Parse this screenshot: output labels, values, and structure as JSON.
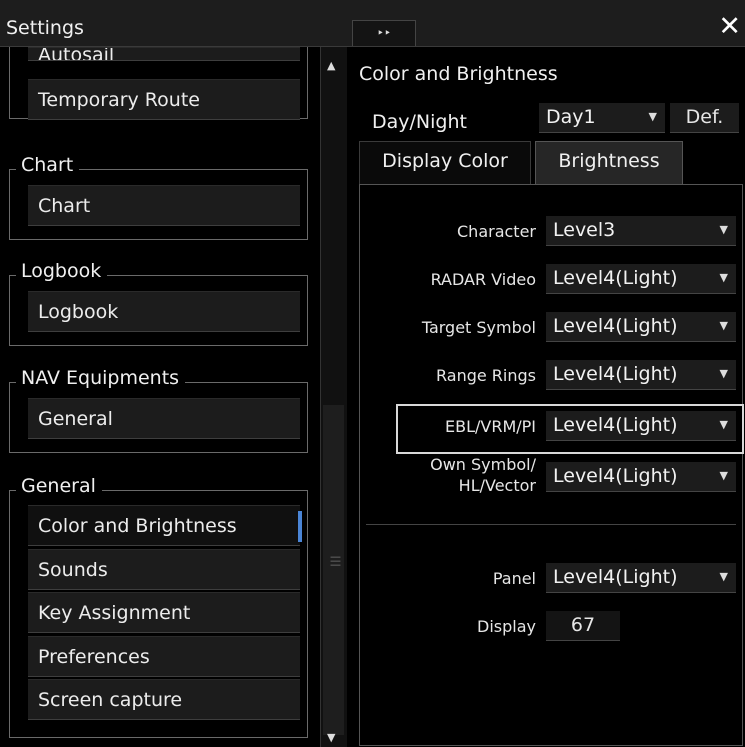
{
  "window": {
    "title": "Settings",
    "expand_icon": "‣‣",
    "close_icon": "✕"
  },
  "sidebar": {
    "items_top": [
      {
        "label": "Autosail"
      },
      {
        "label": "Temporary Route"
      }
    ],
    "groups": [
      {
        "label": "Chart",
        "items": [
          "Chart"
        ]
      },
      {
        "label": "Logbook",
        "items": [
          "Logbook"
        ]
      },
      {
        "label": "NAV Equipments",
        "items": [
          "General"
        ]
      },
      {
        "label": "General",
        "items": [
          "Color and Brightness",
          "Sounds",
          "Key Assignment",
          "Preferences",
          "Screen capture"
        ]
      }
    ],
    "selected": "Color and Brightness",
    "accent_color": "#4a85d6"
  },
  "main": {
    "title": "Color and Brightness",
    "day_night": {
      "label": "Day/Night",
      "value": "Day1",
      "def_label": "Def."
    },
    "tabs": [
      {
        "label": "Display Color",
        "active": false
      },
      {
        "label": "Brightness",
        "active": true
      }
    ],
    "brightness": {
      "character": {
        "label": "Character",
        "value": "Level3"
      },
      "radar_video": {
        "label": "RADAR Video",
        "value": "Level4(Light)"
      },
      "target_symbol": {
        "label": "Target Symbol",
        "value": "Level4(Light)"
      },
      "range_rings": {
        "label": "Range Rings",
        "value": "Level4(Light)"
      },
      "ebl_vrm_pi": {
        "label": "EBL/VRM/PI",
        "value": "Level4(Light)"
      },
      "own_symbol": {
        "label_line1": "Own Symbol/",
        "label_line2": "HL/Vector",
        "value": "Level4(Light)"
      },
      "panel": {
        "label": "Panel",
        "value": "Level4(Light)"
      },
      "display": {
        "label": "Display",
        "value": "67"
      }
    }
  }
}
